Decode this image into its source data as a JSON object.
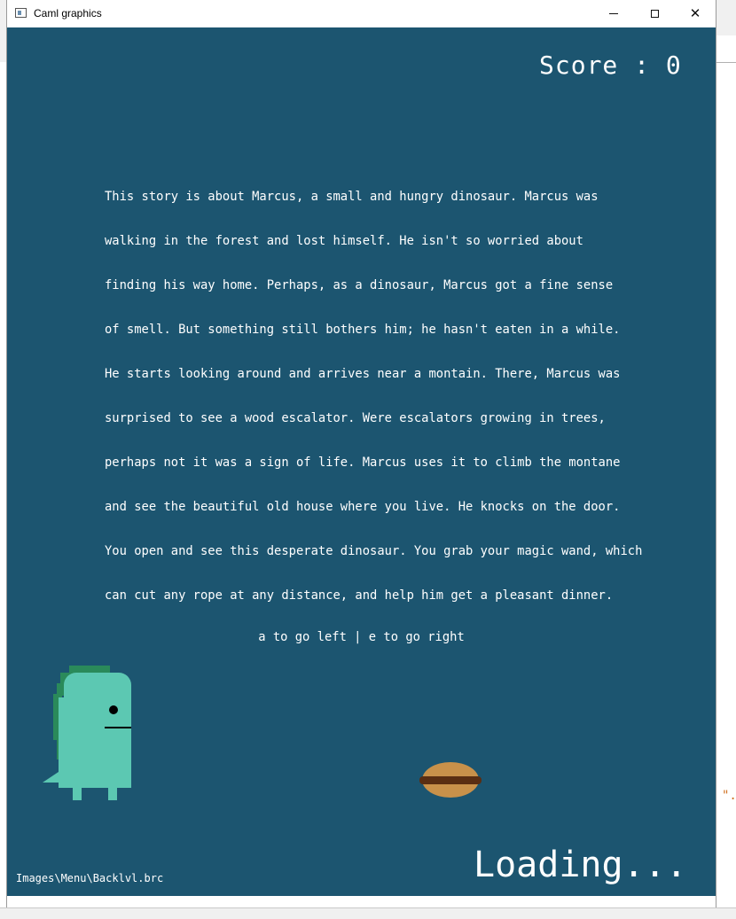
{
  "window": {
    "title": "Caml graphics"
  },
  "game": {
    "score_label": "Score : 0",
    "story_lines": [
      "This story is about Marcus, a small and hungry dinosaur. Marcus was",
      "walking in the forest and lost himself. He isn't so worried about",
      "finding his way home. Perhaps, as a dinosaur, Marcus got a fine sense",
      "of smell. But something still bothers him; he hasn't eaten in a while.",
      "He starts looking around and arrives near a montain. There, Marcus was",
      "surprised to see a wood escalator. Were escalators growing in trees,",
      "perhaps not it was a sign of life. Marcus uses it to climb the montane",
      "and see the beautiful old house where you live. He knocks on the door.",
      "You open and see this desperate dinosaur. You grab your magic wand, which",
      "can cut any rope at any distance, and help him get a pleasant dinner."
    ],
    "controls_hint": "a to go left | e to go right",
    "level_file": "Images\\Menu\\Backlvl.brc",
    "loading_text": "Loading...",
    "colors": {
      "background": "#1c5570",
      "dino_body": "#5cc8b2",
      "dino_spikes": "#2a8a5a",
      "burger_bun": "#c8914a",
      "burger_patty": "#5a2e12"
    }
  },
  "background_app": {
    "stray_text": "\"."
  }
}
